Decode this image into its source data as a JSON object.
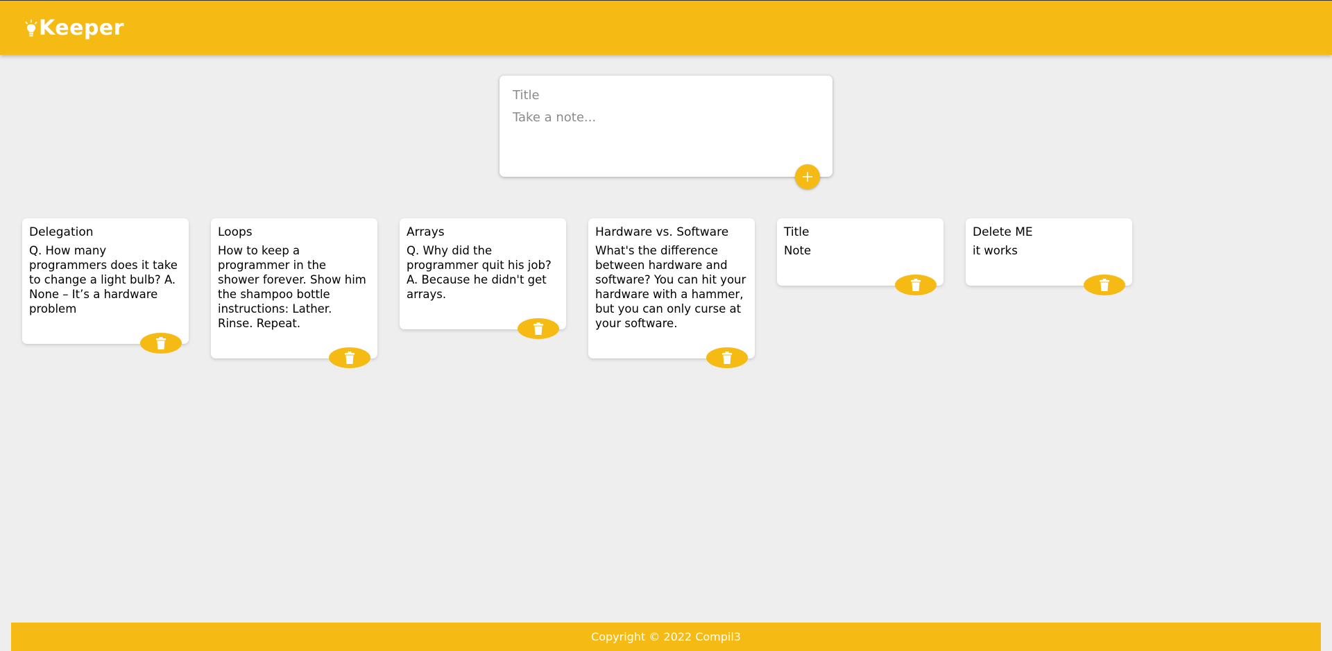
{
  "header": {
    "app_name": "Keeper",
    "logo_icon": "lightbulb-icon",
    "accent_color": "#f5ba13"
  },
  "create_note": {
    "title_placeholder": "Title",
    "content_placeholder": "Take a note...",
    "add_icon": "plus-icon"
  },
  "notes": [
    {
      "title": "Delegation",
      "content": "Q. How many programmers does it take to change a light bulb? A. None – It’s a hardware problem"
    },
    {
      "title": "Loops",
      "content": "How to keep a programmer in the shower forever. Show him the shampoo bottle instructions: Lather. Rinse. Repeat."
    },
    {
      "title": "Arrays",
      "content": "Q. Why did the programmer quit his job? A. Because he didn't get arrays."
    },
    {
      "title": "Hardware vs. Software",
      "content": "What's the difference between hardware and software? You can hit your hardware with a hammer, but you can only curse at your software."
    },
    {
      "title": "Title",
      "content": "Note"
    },
    {
      "title": "Delete ME",
      "content": "it works"
    }
  ],
  "delete_icon": "trash-icon",
  "footer": {
    "copyright": "Copyright © 2022 Compil3"
  }
}
